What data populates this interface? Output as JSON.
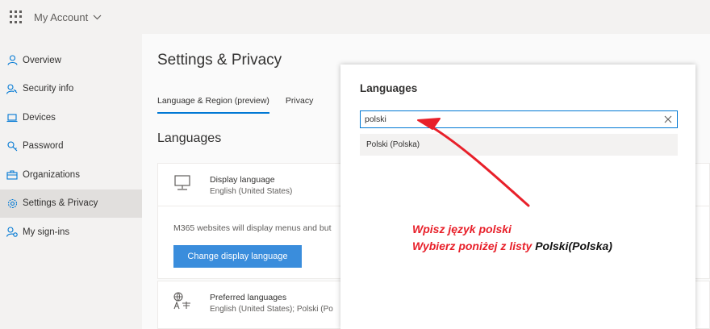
{
  "app": {
    "title": "My Account"
  },
  "sidebar": {
    "items": [
      {
        "label": "Overview",
        "icon": "person-icon"
      },
      {
        "label": "Security info",
        "icon": "security-info-icon"
      },
      {
        "label": "Devices",
        "icon": "laptop-icon"
      },
      {
        "label": "Password",
        "icon": "key-icon"
      },
      {
        "label": "Organizations",
        "icon": "briefcase-icon"
      },
      {
        "label": "Settings & Privacy",
        "icon": "gear-icon",
        "active": true
      },
      {
        "label": "My sign-ins",
        "icon": "sign-ins-icon"
      }
    ]
  },
  "main": {
    "page_title": "Settings & Privacy",
    "tabs": [
      {
        "label": "Language & Region (preview)",
        "active": true
      },
      {
        "label": "Privacy"
      }
    ],
    "section_title": "Languages",
    "display_language": {
      "title": "Display language",
      "value": "English (United States)",
      "description": "M365 websites will display menus and but",
      "button": "Change display language"
    },
    "preferred_languages": {
      "title": "Preferred languages",
      "value": "English (United States); Polski (Po"
    }
  },
  "panel": {
    "title": "Languages",
    "search_value": "polski",
    "suggestion": "Polski (Polska)"
  },
  "annotation": {
    "line1": "Wpisz język polski",
    "line2_prefix": "Wybierz poniżej z listy ",
    "line2_highlight": "Polski(Polska)"
  },
  "colors": {
    "accent": "#0078d4",
    "button": "#3a8ddc",
    "annotation_red": "#e8202a",
    "sidebar_bg": "#f3f2f1"
  }
}
